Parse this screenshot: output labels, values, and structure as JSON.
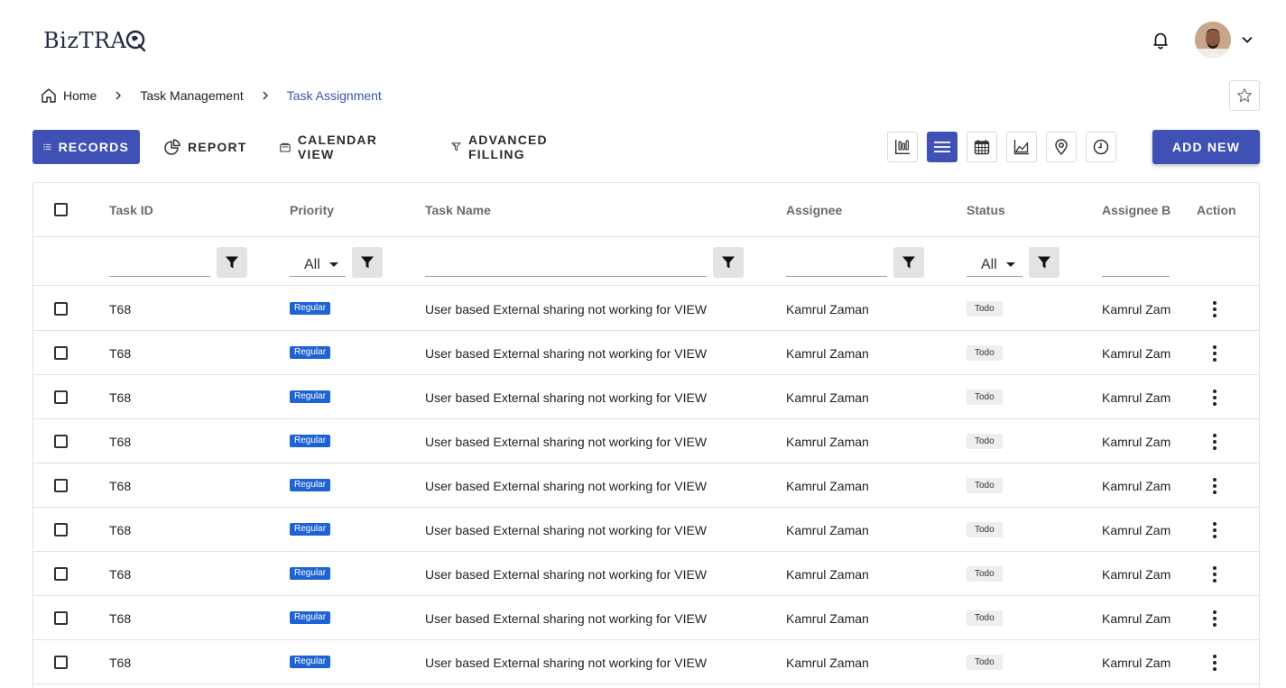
{
  "brand": {
    "logo_text": "BizTRA"
  },
  "header": {
    "user_avatar": "avatar",
    "accent": "#3f51b5"
  },
  "breadcrumb": {
    "items": [
      {
        "label": "Home"
      },
      {
        "label": "Task Management"
      },
      {
        "label": "Task Assignment"
      }
    ]
  },
  "tabs": [
    {
      "label": "RECORDS",
      "active": true,
      "icon": "list-icon"
    },
    {
      "label": "REPORT",
      "active": false,
      "icon": "pie-chart-icon"
    },
    {
      "label": "CALENDAR VIEW",
      "active": false,
      "icon": "calendar-view-icon"
    },
    {
      "label": "ADVANCED FILLING",
      "active": false,
      "icon": "funnel-outline-icon"
    }
  ],
  "view_buttons": [
    {
      "icon": "kanban-icon",
      "active": false
    },
    {
      "icon": "list-lines-icon",
      "active": true
    },
    {
      "icon": "calendar-grid-icon",
      "active": false
    },
    {
      "icon": "area-chart-icon",
      "active": false
    },
    {
      "icon": "location-pin-icon",
      "active": false
    },
    {
      "icon": "clock-icon",
      "active": false
    }
  ],
  "add_new_label": "ADD NEW",
  "table": {
    "columns": [
      "Task ID",
      "Priority",
      "Task Name",
      "Assignee",
      "Status",
      "Assignee By",
      "Action"
    ],
    "filters": {
      "priority_value": "All",
      "status_value": "All"
    },
    "rows": [
      {
        "task_id": "T68",
        "priority": "Regular",
        "task_name": "User based External sharing not working for VIEW",
        "assignee": "Kamrul Zaman",
        "status": "Todo",
        "assignee_by": "Kamrul Zaman"
      },
      {
        "task_id": "T68",
        "priority": "Regular",
        "task_name": "User based External sharing not working for VIEW",
        "assignee": "Kamrul Zaman",
        "status": "Todo",
        "assignee_by": "Kamrul Zaman"
      },
      {
        "task_id": "T68",
        "priority": "Regular",
        "task_name": "User based External sharing not working for VIEW",
        "assignee": "Kamrul Zaman",
        "status": "Todo",
        "assignee_by": "Kamrul Zaman"
      },
      {
        "task_id": "T68",
        "priority": "Regular",
        "task_name": "User based External sharing not working for VIEW",
        "assignee": "Kamrul Zaman",
        "status": "Todo",
        "assignee_by": "Kamrul Zaman"
      },
      {
        "task_id": "T68",
        "priority": "Regular",
        "task_name": "User based External sharing not working for VIEW",
        "assignee": "Kamrul Zaman",
        "status": "Todo",
        "assignee_by": "Kamrul Zaman"
      },
      {
        "task_id": "T68",
        "priority": "Regular",
        "task_name": "User based External sharing not working for VIEW",
        "assignee": "Kamrul Zaman",
        "status": "Todo",
        "assignee_by": "Kamrul Zaman"
      },
      {
        "task_id": "T68",
        "priority": "Regular",
        "task_name": "User based External sharing not working for VIEW",
        "assignee": "Kamrul Zaman",
        "status": "Todo",
        "assignee_by": "Kamrul Zaman"
      },
      {
        "task_id": "T68",
        "priority": "Regular",
        "task_name": "User based External sharing not working for VIEW",
        "assignee": "Kamrul Zaman",
        "status": "Todo",
        "assignee_by": "Kamrul Zaman"
      },
      {
        "task_id": "T68",
        "priority": "Regular",
        "task_name": "User based External sharing not working for VIEW",
        "assignee": "Kamrul Zaman",
        "status": "Todo",
        "assignee_by": "Kamrul Zaman"
      }
    ]
  }
}
